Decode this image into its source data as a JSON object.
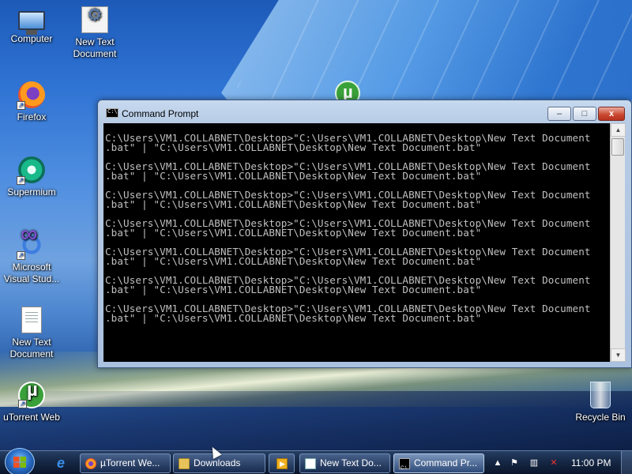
{
  "desktop": {
    "icons": [
      {
        "label": "Computer"
      },
      {
        "label": "New Text Document"
      },
      {
        "label": "Firefox"
      },
      {
        "label": "Supermium"
      },
      {
        "label": "Microsoft Visual Stud..."
      },
      {
        "label": "New Text Document"
      },
      {
        "label": "uTorrent Web"
      },
      {
        "label": "Recycle Bin"
      }
    ]
  },
  "window": {
    "title": "Command Prompt",
    "controls": {
      "minimize": "–",
      "maximize": "□",
      "close": "x"
    },
    "console_lines": [
      "C:\\Users\\VM1.COLLABNET\\Desktop>\"C:\\Users\\VM1.COLLABNET\\Desktop\\New Text Document",
      ".bat\" | \"C:\\Users\\VM1.COLLABNET\\Desktop\\New Text Document.bat\"",
      "",
      "C:\\Users\\VM1.COLLABNET\\Desktop>\"C:\\Users\\VM1.COLLABNET\\Desktop\\New Text Document",
      ".bat\" | \"C:\\Users\\VM1.COLLABNET\\Desktop\\New Text Document.bat\"",
      "",
      "C:\\Users\\VM1.COLLABNET\\Desktop>\"C:\\Users\\VM1.COLLABNET\\Desktop\\New Text Document",
      ".bat\" | \"C:\\Users\\VM1.COLLABNET\\Desktop\\New Text Document.bat\"",
      "",
      "C:\\Users\\VM1.COLLABNET\\Desktop>\"C:\\Users\\VM1.COLLABNET\\Desktop\\New Text Document",
      ".bat\" | \"C:\\Users\\VM1.COLLABNET\\Desktop\\New Text Document.bat\"",
      "",
      "C:\\Users\\VM1.COLLABNET\\Desktop>\"C:\\Users\\VM1.COLLABNET\\Desktop\\New Text Document",
      ".bat\" | \"C:\\Users\\VM1.COLLABNET\\Desktop\\New Text Document.bat\"",
      "",
      "C:\\Users\\VM1.COLLABNET\\Desktop>\"C:\\Users\\VM1.COLLABNET\\Desktop\\New Text Document",
      ".bat\" | \"C:\\Users\\VM1.COLLABNET\\Desktop\\New Text Document.bat\"",
      "",
      "C:\\Users\\VM1.COLLABNET\\Desktop>\"C:\\Users\\VM1.COLLABNET\\Desktop\\New Text Document",
      ".bat\" | \"C:\\Users\\VM1.COLLABNET\\Desktop\\New Text Document.bat\""
    ]
  },
  "taskbar": {
    "buttons": [
      {
        "label": "µTorrent We...",
        "icon": "firefox-icon"
      },
      {
        "label": "Downloads",
        "icon": "folder-icon"
      },
      {
        "label": "",
        "icon": "media-player-icon"
      },
      {
        "label": "New Text Do...",
        "icon": "notepad-icon"
      },
      {
        "label": "Command Pr...",
        "icon": "cmd-icon"
      }
    ],
    "tray": {
      "clock": "11:00 PM",
      "icons": [
        "show-hidden-icons-arrow",
        "action-center-flag-icon",
        "network-icon",
        "volume-muted-icon"
      ]
    }
  },
  "colors": {
    "console_bg": "#000000",
    "console_fg": "#c0c0c0",
    "close_button": "#c9452d"
  }
}
